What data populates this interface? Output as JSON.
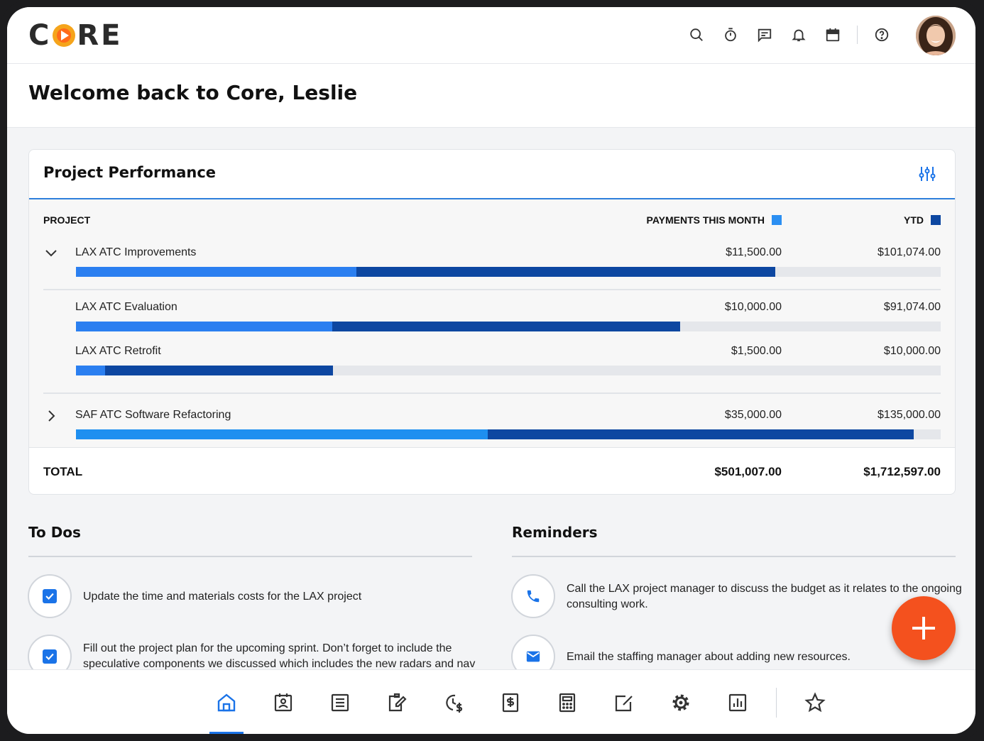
{
  "app": {
    "logo": "CORE"
  },
  "header": {
    "icons": [
      "search-icon",
      "timer-icon",
      "message-icon",
      "bell-icon",
      "calendar-icon",
      "help-icon"
    ],
    "avatar": "user-avatar"
  },
  "welcome": {
    "title": "Welcome back to Core, Leslie"
  },
  "performance": {
    "title": "Project Performance",
    "columns": {
      "project": "PROJECT",
      "payments": "PAYMENTS THIS MONTH",
      "ytd": "YTD"
    },
    "colors": {
      "payments": "#2b8ff2",
      "ytd": "#0d47a1"
    },
    "rows": [
      {
        "name": "LAX ATC Improvements",
        "payments": "$11,500.00",
        "ytd": "$101,074.00",
        "expanded": true,
        "payments_fraction": 0.324,
        "ytd_fraction": 0.809
      },
      {
        "name": "LAX ATC Evaluation",
        "payments": "$10,000.00",
        "ytd": "$91,074.00",
        "child": true,
        "payments_fraction": 0.296,
        "ytd_fraction": 0.699
      },
      {
        "name": "LAX ATC Retrofit",
        "payments": "$1,500.00",
        "ytd": "$10,000.00",
        "child": true,
        "payments_fraction": 0.034,
        "ytd_fraction": 0.297
      },
      {
        "name": "SAF ATC Software Refactoring",
        "payments": "$35,000.00",
        "ytd": "$135,000.00",
        "expanded": false,
        "payments_fraction": 0.476,
        "ytd_fraction": 0.969
      }
    ],
    "total": {
      "label": "TOTAL",
      "payments": "$501,007.00",
      "ytd": "$1,712,597.00"
    }
  },
  "todos": {
    "title": "To Dos",
    "items": [
      {
        "text": "Update the time and materials costs for the LAX project",
        "checked": true
      },
      {
        "text": "Fill out the project plan for the upcoming sprint.  Don’t forget to include the speculative components we discussed which includes the new radars and nav",
        "checked": true
      }
    ]
  },
  "reminders": {
    "title": "Reminders",
    "items": [
      {
        "text": "Call the LAX project manager to discuss the budget as it relates to the ongoing consulting work.",
        "icon": "phone-icon"
      },
      {
        "text": "Email the staffing manager about adding new resources.",
        "icon": "mail-icon"
      }
    ]
  },
  "fab": {
    "icon": "plus-icon"
  },
  "bottom_nav": {
    "active": "home",
    "items": [
      "home",
      "contacts",
      "list",
      "edit-document",
      "time-money",
      "invoice",
      "calculator",
      "approvals",
      "settings",
      "reports",
      "favorites"
    ]
  }
}
